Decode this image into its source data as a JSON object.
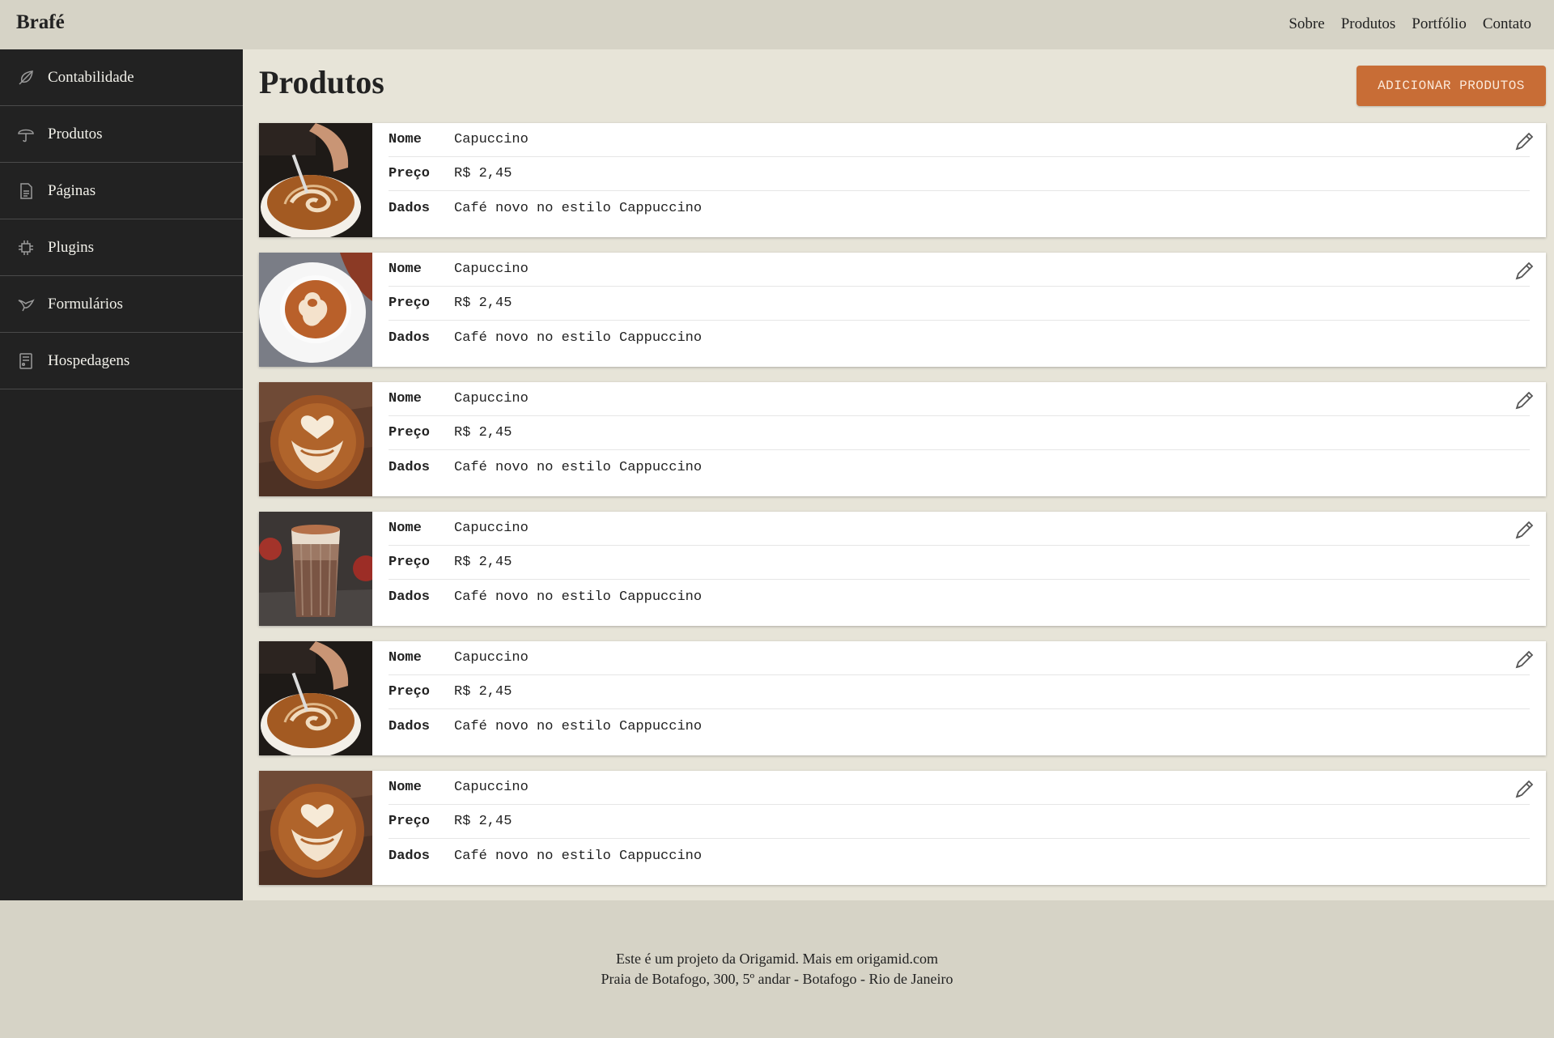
{
  "header": {
    "brand": "Brafé",
    "nav": [
      "Sobre",
      "Produtos",
      "Portfólio",
      "Contato"
    ]
  },
  "sidebar": {
    "items": [
      {
        "label": "Contabilidade",
        "icon": "leaf-icon"
      },
      {
        "label": "Produtos",
        "icon": "umbrella-icon"
      },
      {
        "label": "Páginas",
        "icon": "document-icon"
      },
      {
        "label": "Plugins",
        "icon": "plug-icon"
      },
      {
        "label": "Formulários",
        "icon": "bird-icon"
      },
      {
        "label": "Hospedagens",
        "icon": "server-icon"
      }
    ]
  },
  "main": {
    "title": "Produtos",
    "add_button": "ADICIONAR PRODUTOS",
    "labels": {
      "nome": "Nome",
      "preco": "Preço",
      "dados": "Dados"
    },
    "products": [
      {
        "nome": "Capuccino",
        "preco": "R$ 2,45",
        "dados": "Café novo no estilo Cappuccino",
        "image": "latte-pour"
      },
      {
        "nome": "Capuccino",
        "preco": "R$ 2,45",
        "dados": "Café novo no estilo Cappuccino",
        "image": "latte-saucer"
      },
      {
        "nome": "Capuccino",
        "preco": "R$ 2,45",
        "dados": "Café novo no estilo Cappuccino",
        "image": "latte-art-top"
      },
      {
        "nome": "Capuccino",
        "preco": "R$ 2,45",
        "dados": "Café novo no estilo Cappuccino",
        "image": "glass-mocha"
      },
      {
        "nome": "Capuccino",
        "preco": "R$ 2,45",
        "dados": "Café novo no estilo Cappuccino",
        "image": "latte-pour"
      },
      {
        "nome": "Capuccino",
        "preco": "R$ 2,45",
        "dados": "Café novo no estilo Cappuccino",
        "image": "latte-art-top"
      }
    ]
  },
  "footer": {
    "line1": "Este é um projeto da Origamid. Mais em origamid.com",
    "line2": "Praia de Botafogo, 300, 5º andar - Botafogo - Rio de Janeiro"
  },
  "colors": {
    "header_bg": "#d6d3c6",
    "sidebar_bg": "#222222",
    "main_bg": "#e7e4d8",
    "accent": "#c86d36"
  }
}
